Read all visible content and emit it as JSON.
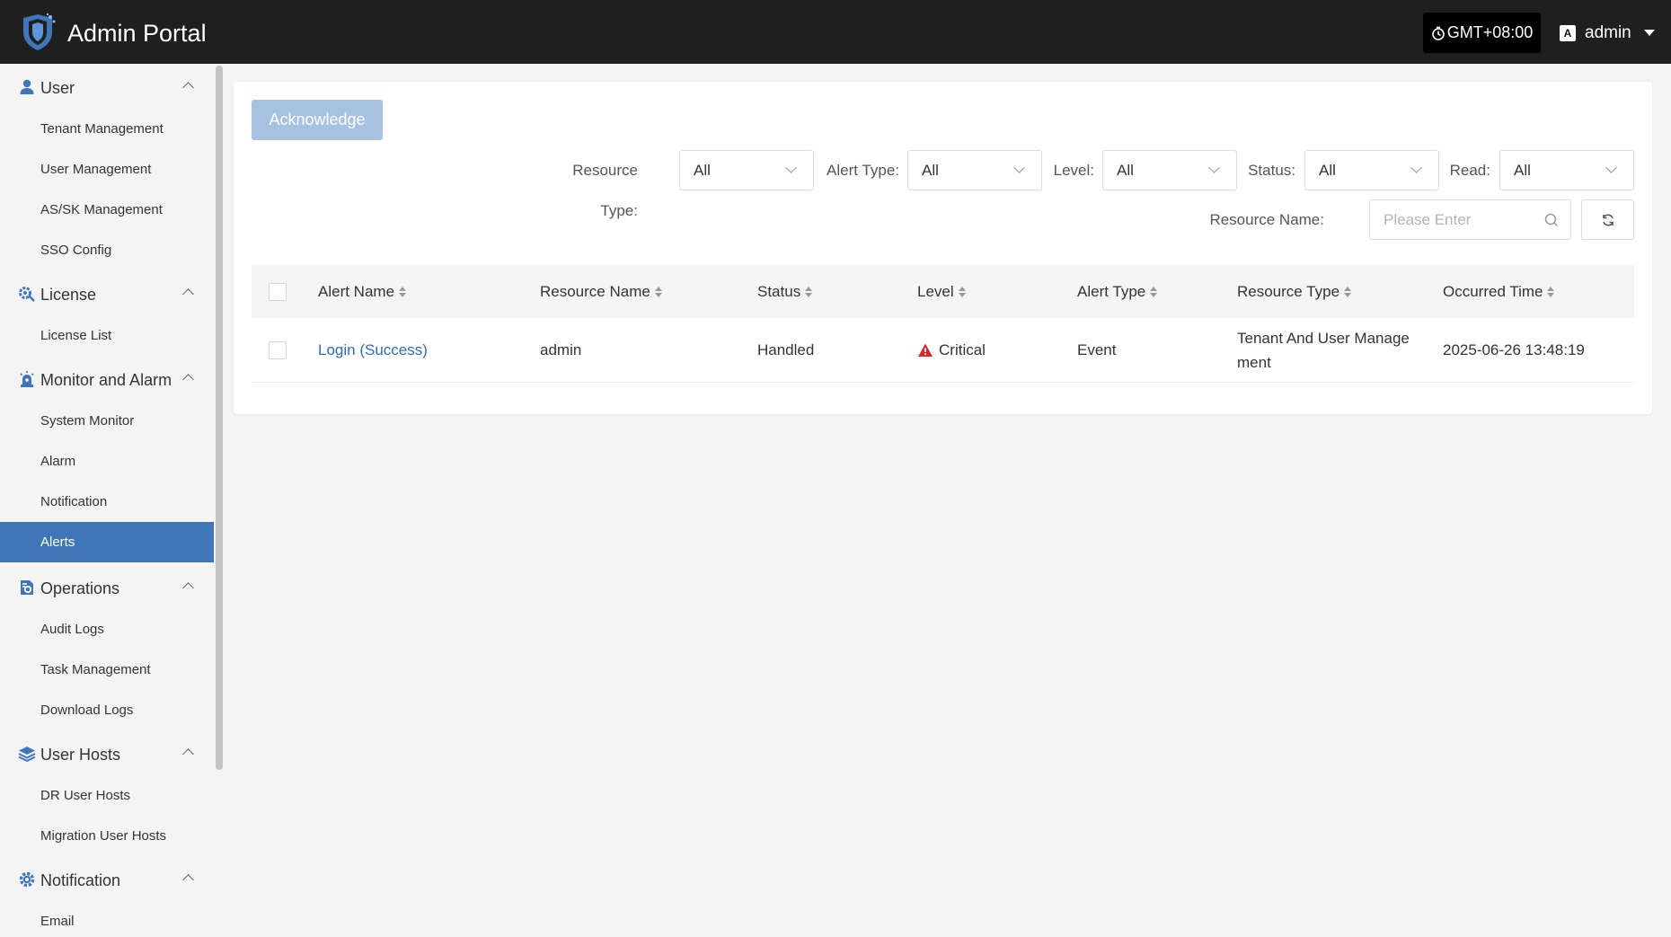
{
  "header": {
    "title": "Admin Portal",
    "timezone": "GMT+08:00",
    "lang_glyph": "A",
    "user": "admin"
  },
  "sidebar": {
    "groups": [
      {
        "label": "User",
        "icon": "user-icon",
        "items": [
          "Tenant Management",
          "User Management",
          "AS/SK Management",
          "SSO Config"
        ]
      },
      {
        "label": "License",
        "icon": "license-gear-icon",
        "items": [
          "License List"
        ]
      },
      {
        "label": "Monitor and Alarm",
        "icon": "alarm-icon",
        "items": [
          "System Monitor",
          "Alarm",
          "Notification",
          "Alerts"
        ]
      },
      {
        "label": "Operations",
        "icon": "operations-icon",
        "items": [
          "Audit Logs",
          "Task Management",
          "Download Logs"
        ]
      },
      {
        "label": "User Hosts",
        "icon": "layers-icon",
        "items": [
          "DR User Hosts",
          "Migration User Hosts"
        ]
      },
      {
        "label": "Notification",
        "icon": "gear-icon",
        "items": [
          "Email"
        ]
      }
    ],
    "active_item": "Alerts"
  },
  "toolbar": {
    "acknowledge_label": "Acknowledge"
  },
  "filters": {
    "resource_type": {
      "label": "Resource Type:",
      "value": "All"
    },
    "alert_type": {
      "label": "Alert Type:",
      "value": "All"
    },
    "level": {
      "label": "Level:",
      "value": "All"
    },
    "status": {
      "label": "Status:",
      "value": "All"
    },
    "read": {
      "label": "Read:",
      "value": "All"
    },
    "resource_name": {
      "label": "Resource Name:",
      "placeholder": "Please Enter"
    }
  },
  "table": {
    "columns": [
      "Alert Name",
      "Resource Name",
      "Status",
      "Level",
      "Alert Type",
      "Resource Type",
      "Occurred Time"
    ],
    "rows": [
      {
        "alert_name": "Login (Success)",
        "resource_name": "admin",
        "status": "Handled",
        "level": "Critical",
        "alert_type": "Event",
        "resource_type": "Tenant And User Manage ment",
        "occurred_time": "2025-06-26 13:48:19"
      }
    ]
  },
  "colors": {
    "header_bg": "#1f1f1f",
    "active_menu": "#3f76b9",
    "link": "#2f6db5",
    "critical": "#d9262b",
    "acknowledge_disabled": "#a5c2e0"
  }
}
